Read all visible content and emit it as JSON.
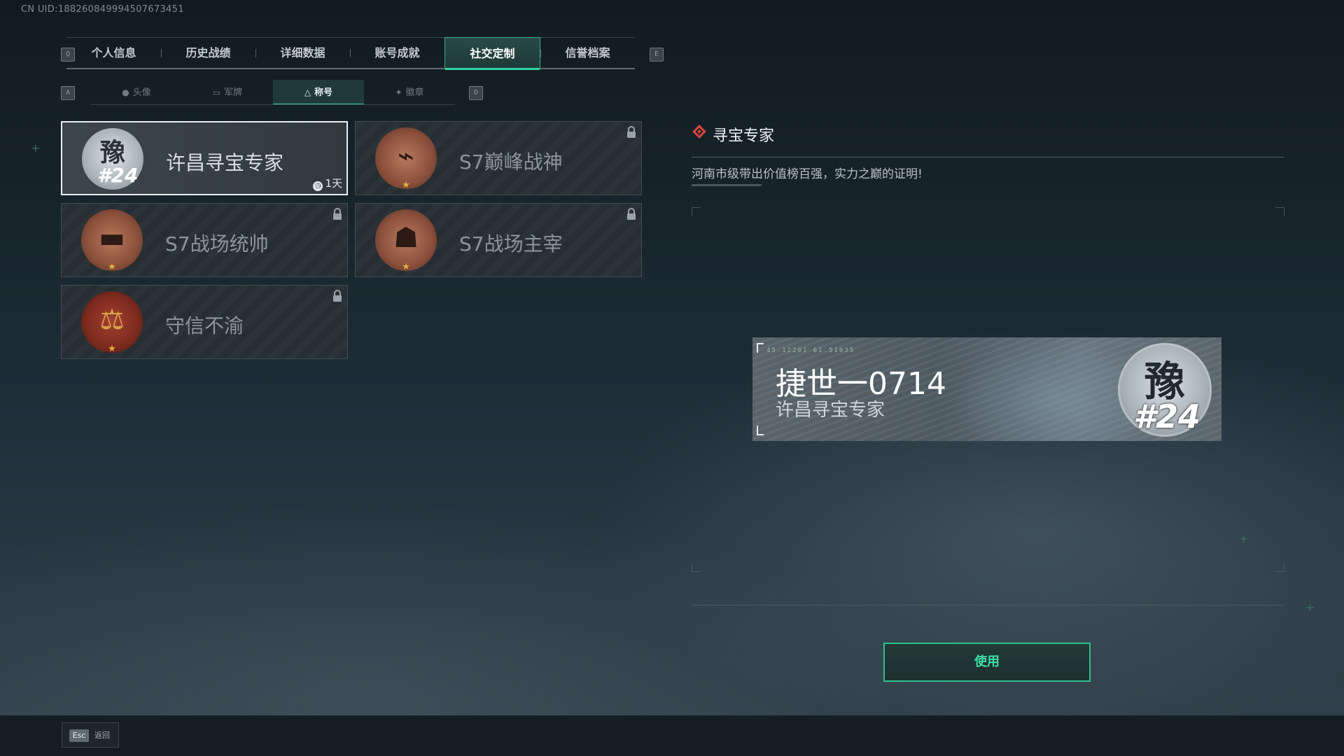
{
  "uid": "CN UID:1882608499945076734​51",
  "tabs": {
    "left_key": "Q",
    "right_key": "E",
    "items": [
      "个人信息",
      "历史战绩",
      "详细数据",
      "账号成就",
      "社交定制",
      "信誉档案"
    ],
    "active_index": 4
  },
  "subtabs": {
    "left_key": "A",
    "right_key": "D",
    "items": [
      {
        "label": "头像",
        "icon": "person-icon"
      },
      {
        "label": "军牌",
        "icon": "dogtag-icon"
      },
      {
        "label": "称号",
        "icon": "title-icon"
      },
      {
        "label": "徽章",
        "icon": "emblem-icon"
      }
    ],
    "active_index": 2
  },
  "titles": [
    {
      "label": "许昌寻宝专家",
      "badge_char": "豫",
      "badge_num": "#24",
      "timer": "1天",
      "locked": false,
      "selected": true
    },
    {
      "label": "S7巅峰战神",
      "locked": true,
      "selected": false
    },
    {
      "label": "S7战场统帅",
      "locked": true,
      "selected": false
    },
    {
      "label": "S7战场主宰",
      "locked": true,
      "selected": false
    },
    {
      "label": "守信不渝",
      "locked": true,
      "selected": false
    }
  ],
  "detail": {
    "title": "寻宝专家",
    "description": "河南市级带出价值榜百强，实力之巅的证明!"
  },
  "nameplate": {
    "coords": "45.12201  61.51035",
    "player_name": "捷世一0714",
    "title": "许昌寻宝专家",
    "badge_char": "豫",
    "badge_num": "#24"
  },
  "use_button": "使用",
  "footer": {
    "esc_key": "Esc",
    "back_label": "返回"
  },
  "colors": {
    "accent": "#2fd39b",
    "lock": "#9aa3a9",
    "diamond": "#e0443e"
  }
}
